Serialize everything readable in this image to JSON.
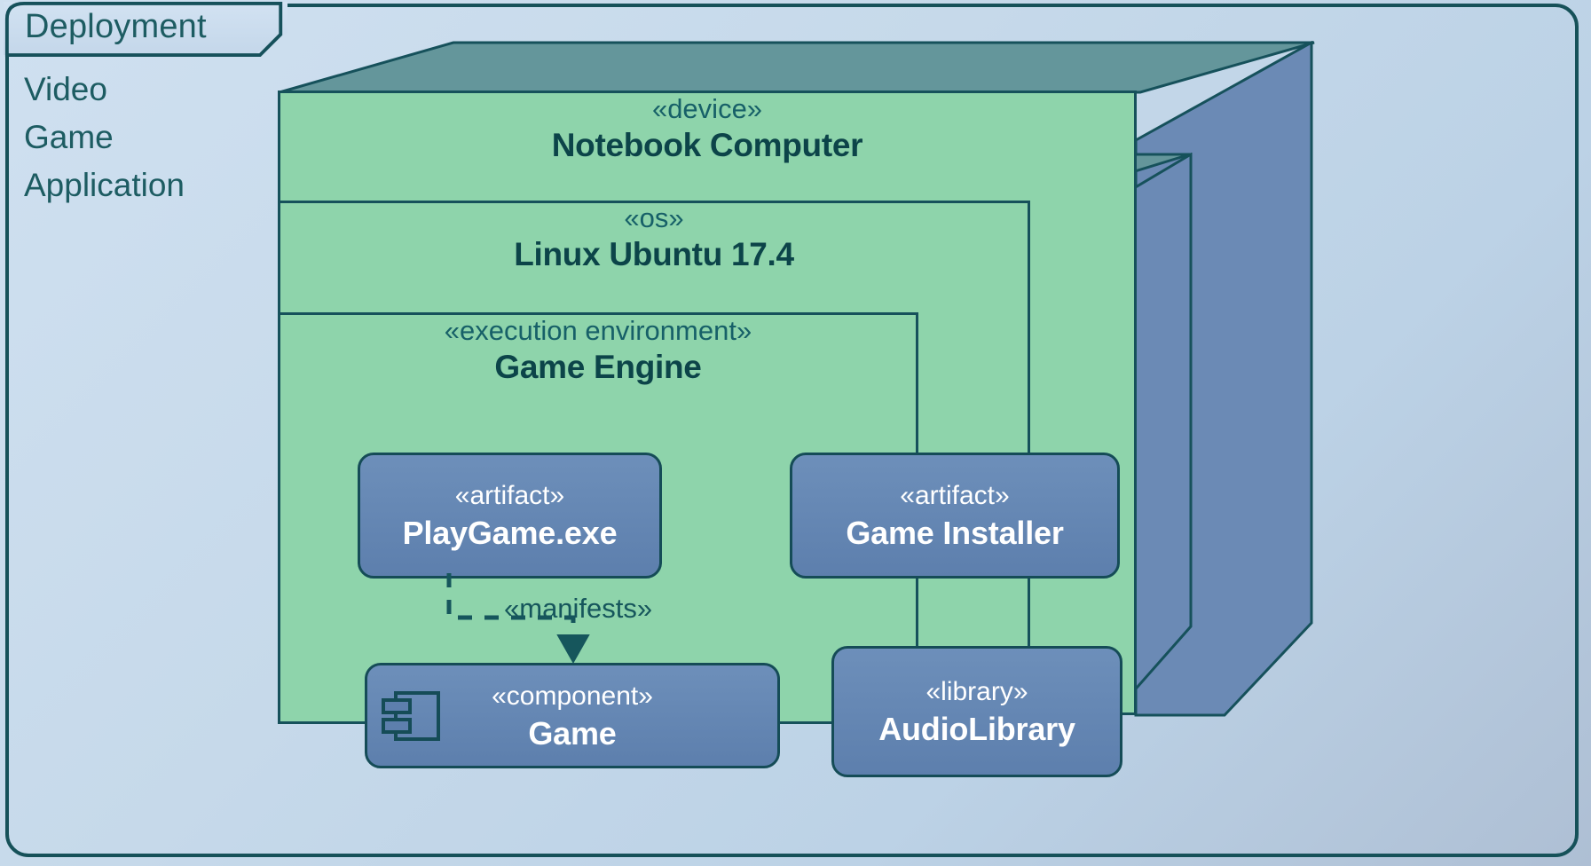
{
  "frame": {
    "tab_label": "Deployment",
    "subtitle": "Video\nGame\nApplication",
    "subtitle_lines": [
      "Video",
      "Game",
      "Application"
    ]
  },
  "colors": {
    "background_top": "#cfe0f0",
    "background_bottom": "#aebfd4",
    "node_front": "#8ed4ab",
    "node_top": "#64969b",
    "node_side": "#6b8ab5",
    "box_fill": "#5d7fad",
    "stroke": "#16515b",
    "text_dark": "#0c4449",
    "text_light": "#ffffff"
  },
  "nodes": [
    {
      "id": "notebook-computer",
      "stereotype": "«device»",
      "name": "Notebook Computer"
    },
    {
      "id": "linux-ubuntu",
      "stereotype": "«os»",
      "name": "Linux Ubuntu 17.4"
    },
    {
      "id": "game-engine",
      "stereotype": "«execution environment»",
      "name": "Game Engine"
    }
  ],
  "boxes": [
    {
      "id": "playgame-exe",
      "stereotype": "«artifact»",
      "name": "PlayGame.exe",
      "icon": null
    },
    {
      "id": "game-installer",
      "stereotype": "«artifact»",
      "name": "Game Installer",
      "icon": null
    },
    {
      "id": "game-component",
      "stereotype": "«component»",
      "name": "Game",
      "icon": "component-icon"
    },
    {
      "id": "audio-library",
      "stereotype": "«library»",
      "name": "AudioLibrary",
      "icon": null
    }
  ],
  "relations": [
    {
      "id": "manifests",
      "label": "«manifests»",
      "from": "playgame-exe",
      "to": "game-component",
      "style": "dashed",
      "arrowhead": "filled-triangle"
    }
  ]
}
